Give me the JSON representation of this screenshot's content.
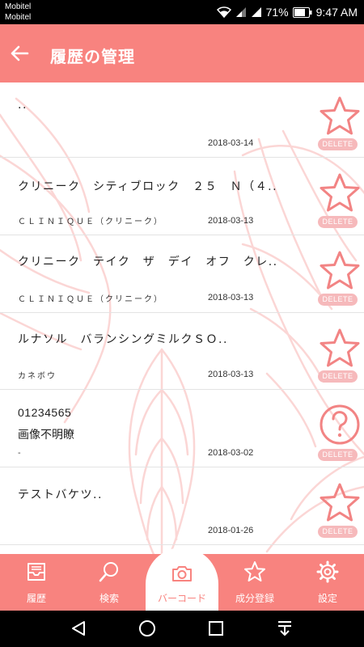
{
  "status_bar": {
    "carrier_1": "Mobitel",
    "carrier_2": "Mobitel",
    "battery": "71%",
    "time": "9:47 AM"
  },
  "header": {
    "title": "履歴の管理",
    "back_icon": "arrow-left-icon"
  },
  "colors": {
    "accent": "#f8837f",
    "delete_badge": "#f6b9bb",
    "leaf_pattern": "#fbd6d5"
  },
  "history": [
    {
      "name": "..",
      "brand": "",
      "date": "2018-03-14",
      "icon": "star-outline-icon",
      "delete_label": "DELETE"
    },
    {
      "name": "クリニーク　シティブロック　２５　Ｎ（４..",
      "brand": "ＣＬＩＮＩＱＵＥ（クリニーク）",
      "date": "2018-03-13",
      "icon": "star-outline-icon",
      "delete_label": "DELETE"
    },
    {
      "name": "クリニーク　テイク　ザ　デイ　オフ　クレ..",
      "brand": "ＣＬＩＮＩＱＵＥ（クリニーク）",
      "date": "2018-03-13",
      "icon": "star-outline-icon",
      "delete_label": "DELETE"
    },
    {
      "name": "ルナソル　バランシングミルクＳＯ..",
      "brand": "カネボウ",
      "date": "2018-03-13",
      "icon": "star-outline-icon",
      "delete_label": "DELETE"
    },
    {
      "name": "01234565",
      "sub": "画像不明瞭",
      "brand": "-",
      "date": "2018-03-02",
      "icon": "question-circle-icon",
      "delete_label": "DELETE"
    },
    {
      "name": "テストバケツ..",
      "brand": "",
      "date": "2018-01-26",
      "icon": "star-outline-icon",
      "delete_label": "DELETE"
    }
  ],
  "bottom_nav": [
    {
      "label": "履歴",
      "icon": "inbox-tray-icon",
      "active": false
    },
    {
      "label": "検索",
      "icon": "search-icon",
      "active": false
    },
    {
      "label": "バーコード",
      "icon": "camera-icon",
      "active": true
    },
    {
      "label": "成分登録",
      "icon": "star-icon",
      "active": false
    },
    {
      "label": "設定",
      "icon": "gear-icon",
      "active": false
    }
  ],
  "system_nav": [
    "back-triangle-icon",
    "home-circle-icon",
    "recents-square-icon",
    "notification-pull-icon"
  ]
}
